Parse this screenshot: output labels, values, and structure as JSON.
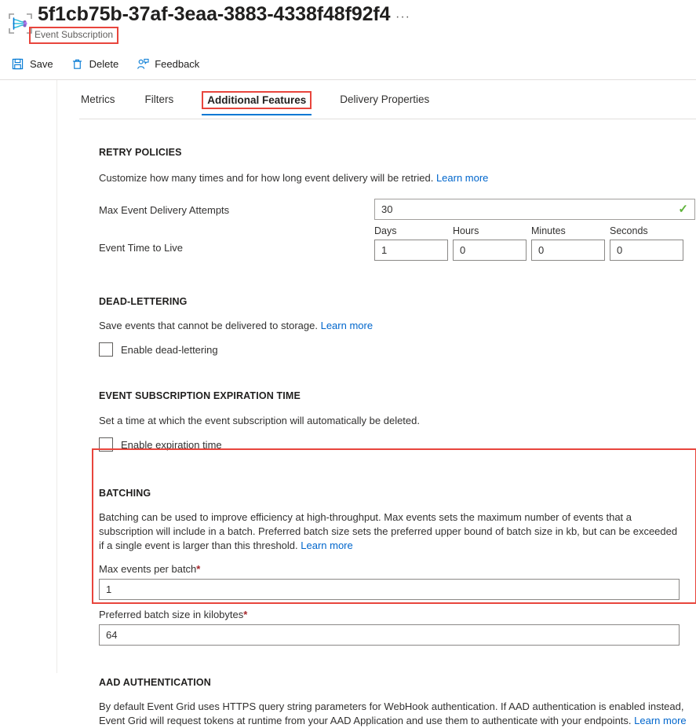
{
  "header": {
    "title": "5f1cb75b-37af-3eaa-3883-4338f48f92f4",
    "subtitle": "Event Subscription",
    "more_label": "···",
    "icon": "event-subscription-icon"
  },
  "commands": [
    {
      "label": "Save",
      "icon": "save-icon"
    },
    {
      "label": "Delete",
      "icon": "delete-icon"
    },
    {
      "label": "Feedback",
      "icon": "feedback-icon"
    }
  ],
  "tabs": [
    {
      "label": "Metrics",
      "active": false
    },
    {
      "label": "Filters",
      "active": false
    },
    {
      "label": "Additional Features",
      "active": true
    },
    {
      "label": "Delivery Properties",
      "active": false
    }
  ],
  "retry_policies": {
    "title": "RETRY POLICIES",
    "description": "Customize how many times and for how long event delivery will be retried.",
    "learn_more": "Learn more",
    "max_attempts_label": "Max Event Delivery Attempts",
    "max_attempts_value": "30",
    "max_attempts_valid_icon": "checkmark-icon",
    "ttl_label": "Event Time to Live",
    "ttl_fields": [
      {
        "label": "Days",
        "value": "1"
      },
      {
        "label": "Hours",
        "value": "0"
      },
      {
        "label": "Minutes",
        "value": "0"
      },
      {
        "label": "Seconds",
        "value": "0"
      }
    ]
  },
  "dead_lettering": {
    "title": "DEAD-LETTERING",
    "description": "Save events that cannot be delivered to storage.",
    "learn_more": "Learn more",
    "checkbox_label": "Enable dead-lettering",
    "checked": false
  },
  "expiration": {
    "title": "EVENT SUBSCRIPTION EXPIRATION TIME",
    "description": "Set a time at which the event subscription will automatically be deleted.",
    "checkbox_label": "Enable expiration time",
    "checked": false
  },
  "batching": {
    "title": "BATCHING",
    "description": "Batching can be used to improve efficiency at high-throughput. Max events sets the maximum number of events that a subscription will include in a batch. Preferred batch size sets the preferred upper bound of batch size in kb, but can be exceeded if a single event is larger than this threshold.",
    "learn_more": "Learn more",
    "max_events_label": "Max events per batch",
    "max_events_required": "*",
    "max_events_value": "1",
    "batch_size_label": "Preferred batch size in kilobytes",
    "batch_size_required": "*",
    "batch_size_value": "64"
  },
  "aad": {
    "title": "AAD AUTHENTICATION",
    "description": "By default Event Grid uses HTTPS query string parameters for WebHook authentication. If AAD authentication is enabled instead, Event Grid will request tokens at runtime from your AAD Application and use them to authenticate with your endpoints.",
    "learn_more": "Learn more"
  },
  "colors": {
    "accent": "#0078d4",
    "highlight_box": "#e8453c",
    "link": "#0066cc",
    "valid_green": "#5eb339",
    "required_red": "#a4262c"
  }
}
